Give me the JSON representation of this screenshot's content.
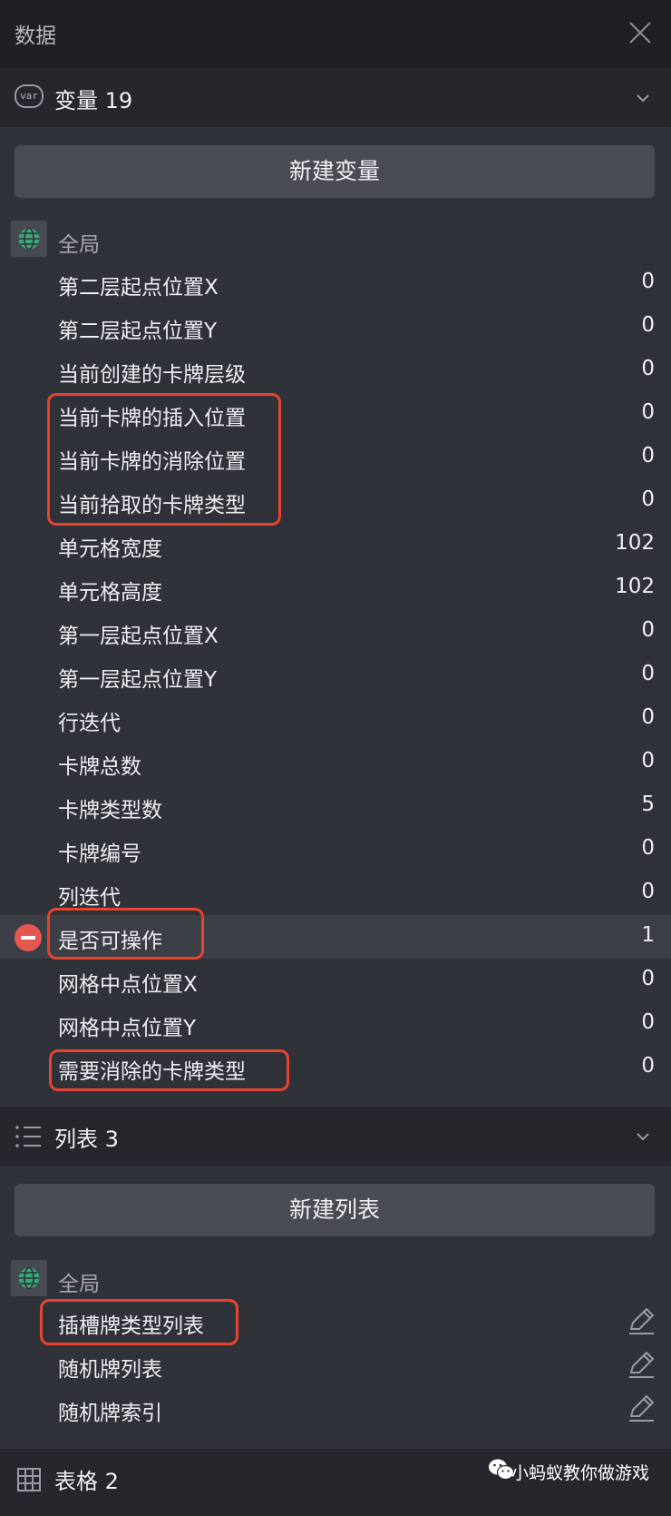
{
  "window": {
    "title": "数据"
  },
  "variables": {
    "header": "变量 19",
    "icon_text": "var",
    "new_button": "新建变量",
    "scope": "全局",
    "items": [
      {
        "name": "第二层起点位置X",
        "value": "0"
      },
      {
        "name": "第二层起点位置Y",
        "value": "0"
      },
      {
        "name": "当前创建的卡牌层级",
        "value": "0"
      },
      {
        "name": "当前卡牌的插入位置",
        "value": "0"
      },
      {
        "name": "当前卡牌的消除位置",
        "value": "0"
      },
      {
        "name": "当前拾取的卡牌类型",
        "value": "0"
      },
      {
        "name": "单元格宽度",
        "value": "102"
      },
      {
        "name": "单元格高度",
        "value": "102"
      },
      {
        "name": "第一层起点位置X",
        "value": "0"
      },
      {
        "name": "第一层起点位置Y",
        "value": "0"
      },
      {
        "name": "行迭代",
        "value": "0"
      },
      {
        "name": "卡牌总数",
        "value": "0"
      },
      {
        "name": "卡牌类型数",
        "value": "5"
      },
      {
        "name": "卡牌编号",
        "value": "0"
      },
      {
        "name": "列迭代",
        "value": "0"
      },
      {
        "name": "是否可操作",
        "value": "1"
      },
      {
        "name": "网格中点位置X",
        "value": "0"
      },
      {
        "name": "网格中点位置Y",
        "value": "0"
      },
      {
        "name": "需要消除的卡牌类型",
        "value": "0"
      }
    ]
  },
  "lists": {
    "header": "列表 3",
    "new_button": "新建列表",
    "scope": "全局",
    "items": [
      {
        "name": "插槽牌类型列表"
      },
      {
        "name": "随机牌列表"
      },
      {
        "name": "随机牌索引"
      }
    ]
  },
  "tables": {
    "header": "表格 2"
  },
  "watermark": "小蚂蚁教你做游戏",
  "colors": {
    "highlight": "#e8432f",
    "remove": "#e8574f",
    "globe": "#3aa776"
  }
}
